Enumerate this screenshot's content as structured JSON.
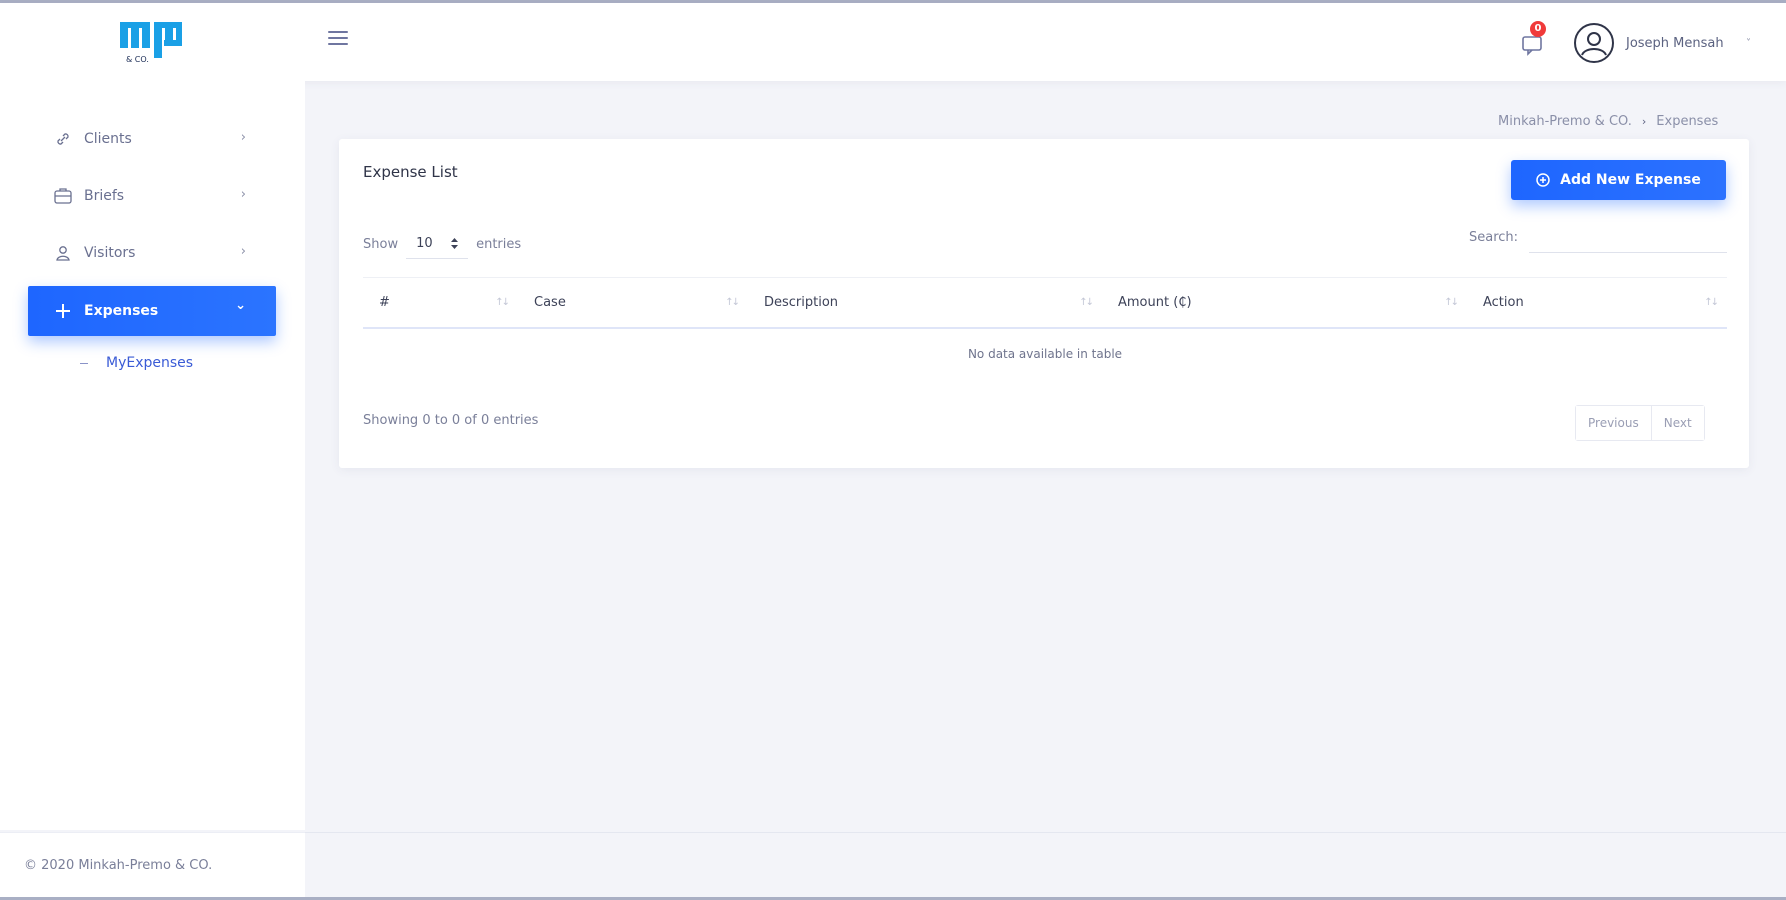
{
  "header": {
    "notification_count": "0",
    "user_name": "Joseph Mensah",
    "user_caret": "˅"
  },
  "sidebar": {
    "items": [
      {
        "label": "Clients",
        "icon": "link-icon"
      },
      {
        "label": "Briefs",
        "icon": "briefcase-icon"
      },
      {
        "label": "Visitors",
        "icon": "user-icon"
      },
      {
        "label": "Expenses",
        "icon": "plus-icon",
        "active": true
      }
    ],
    "submenu": [
      {
        "label": "MyExpenses"
      }
    ],
    "chevron_right": "›",
    "chevron_down": "⌄"
  },
  "breadcrumb": {
    "home": "Minkah-Premo & CO.",
    "separator": "›",
    "current": "Expenses"
  },
  "card": {
    "title": "Expense List",
    "add_button_label": "Add New Expense",
    "show_label": "Show",
    "entries_value": "10",
    "entries_label": "entries",
    "search_label": "Search:",
    "search_placeholder": "",
    "columns": [
      "#",
      "Case",
      "Description",
      "Amount (₵)",
      "Action"
    ],
    "empty_message": "No data available in table",
    "info_text": "Showing 0 to 0 of 0 entries",
    "prev_label": "Previous",
    "next_label": "Next"
  },
  "footer": {
    "text": "© 2020 Minkah-Premo & CO."
  },
  "colors": {
    "accent": "#1e66ff",
    "badge": "#f03a3a",
    "background": "#f3f4f9"
  }
}
